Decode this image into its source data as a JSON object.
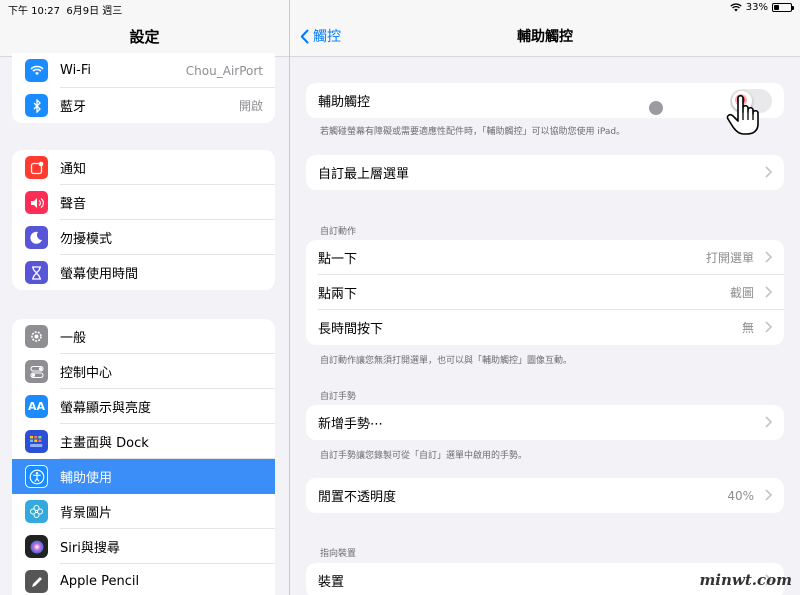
{
  "status_bar": {
    "time": "下午 10:27",
    "date": "6月9日 週三",
    "battery": "33%",
    "battery_level": 0.33
  },
  "left": {
    "title": "設定",
    "groups": [
      {
        "items": [
          {
            "label": "Wi-Fi",
            "value": "Chou_AirPort",
            "icon": "wifi-icon",
            "color": "#1a8cff"
          },
          {
            "label": "藍牙",
            "value": "開啟",
            "icon": "bluetooth-icon",
            "color": "#1a8cff"
          }
        ]
      },
      {
        "items": [
          {
            "label": "通知",
            "icon": "notifications-icon",
            "color": "#ff3b30"
          },
          {
            "label": "聲音",
            "icon": "sound-icon",
            "color": "#ff2d55"
          },
          {
            "label": "勿擾模式",
            "icon": "moon-icon",
            "color": "#5856d6"
          },
          {
            "label": "螢幕使用時間",
            "icon": "hourglass-icon",
            "color": "#5856d6"
          }
        ]
      },
      {
        "items": [
          {
            "label": "一般",
            "icon": "gear-icon",
            "color": "#8e8e93"
          },
          {
            "label": "控制中心",
            "icon": "toggles-icon",
            "color": "#8e8e93"
          },
          {
            "label": "螢幕顯示與亮度",
            "icon": "text-size-icon",
            "color": "#1a8cff"
          },
          {
            "label": "主畫面與 Dock",
            "icon": "home-grid-icon",
            "color": "#2c4fd8"
          },
          {
            "label": "輔助使用",
            "icon": "accessibility-icon",
            "color": "#1a8cff",
            "selected": true
          },
          {
            "label": "背景圖片",
            "icon": "wallpaper-icon",
            "color": "#34aadc"
          },
          {
            "label": "Siri與搜尋",
            "icon": "siri-icon",
            "color": "#222222"
          },
          {
            "label": "Apple Pencil",
            "icon": "pencil-icon",
            "color": "#555555"
          }
        ]
      }
    ]
  },
  "right": {
    "back_label": "觸控",
    "title": "輔助觸控",
    "assistive_touch": {
      "label": "輔助觸控",
      "enabled": false,
      "note": "若觸碰螢幕有障礙或需要適應性配件時，「輔助觸控」可以協助您使用 iPad。"
    },
    "customize_top_menu": "自訂最上層選單",
    "custom_actions": {
      "header": "自訂動作",
      "items": [
        {
          "label": "點一下",
          "value": "打開選單"
        },
        {
          "label": "點兩下",
          "value": "截圖"
        },
        {
          "label": "長時間按下",
          "value": "無"
        }
      ],
      "note": "自訂動作讓您無須打開選單，也可以與「輔助觸控」圖像互動。"
    },
    "custom_gestures": {
      "header": "自訂手勢",
      "new_label": "新增手勢⋯",
      "note": "自訂手勢讓您錄製可從「自訂」選單中啟用的手勢。"
    },
    "idle_opacity": {
      "label": "閒置不透明度",
      "value": "40%"
    },
    "pointer_devices": {
      "header": "指向裝置",
      "devices_label": "裝置"
    }
  },
  "watermark": "minwt.com"
}
